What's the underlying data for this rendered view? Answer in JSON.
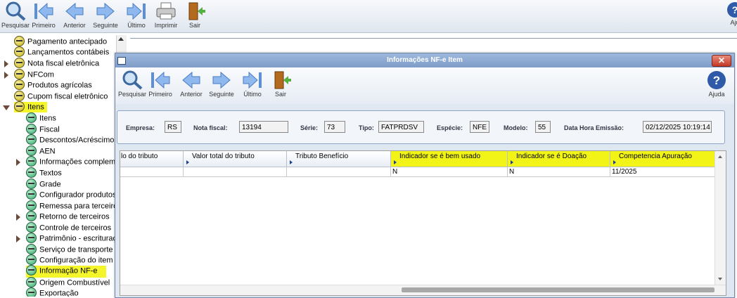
{
  "toolbar": {
    "items": [
      {
        "label": "Pesquisar",
        "icon": "search-icon"
      },
      {
        "label": "Primeiro",
        "icon": "first-arrow-icon"
      },
      {
        "label": "Anterior",
        "icon": "previous-arrow-icon"
      },
      {
        "label": "Seguinte",
        "icon": "next-arrow-icon"
      },
      {
        "label": "Último",
        "icon": "last-arrow-icon"
      },
      {
        "label": "Imprimir",
        "icon": "printer-icon"
      },
      {
        "label": "Sair",
        "icon": "exit-door-icon"
      }
    ],
    "help_label": "Aju"
  },
  "tree": {
    "items": [
      {
        "label": "Pagamento antecipado",
        "type": "folder"
      },
      {
        "label": "Lançamentos contábeis",
        "type": "folder"
      },
      {
        "label": "Nota fiscal eletrônica",
        "type": "folder"
      },
      {
        "label": "NFCom",
        "type": "folder"
      },
      {
        "label": "Produtos agrícolas",
        "type": "folder"
      },
      {
        "label": "Cupom fiscal eletrônico",
        "type": "folder"
      },
      {
        "label": "Itens",
        "type": "folder"
      },
      {
        "label": "Itens",
        "type": "leaf"
      },
      {
        "label": "Fiscal",
        "type": "leaf"
      },
      {
        "label": "Descontos/Acréscimos",
        "type": "leaf"
      },
      {
        "label": "AEN",
        "type": "leaf"
      },
      {
        "label": "Informações compleme",
        "type": "leaf"
      },
      {
        "label": "Textos",
        "type": "leaf"
      },
      {
        "label": "Grade",
        "type": "leaf"
      },
      {
        "label": "Configurador produtos",
        "type": "leaf"
      },
      {
        "label": "Remessa para terceiros",
        "type": "leaf"
      },
      {
        "label": "Retorno de terceiros",
        "type": "leaf"
      },
      {
        "label": "Controle de terceiros",
        "type": "leaf"
      },
      {
        "label": "Patrimônio - escrituraçã",
        "type": "leaf"
      },
      {
        "label": "Serviço de transporte",
        "type": "leaf"
      },
      {
        "label": "Configuração do item",
        "type": "leaf"
      },
      {
        "label": "Informação NF-e",
        "type": "leaf"
      },
      {
        "label": "Origem Combustível",
        "type": "leaf"
      },
      {
        "label": "Exportação",
        "type": "leaf"
      }
    ]
  },
  "dialog": {
    "title": "Informações NF-e Item",
    "close_label": "✕",
    "toolbar": {
      "items": [
        {
          "label": "Pesquisar"
        },
        {
          "label": "Primeiro"
        },
        {
          "label": "Anterior"
        },
        {
          "label": "Seguinte"
        },
        {
          "label": "Último"
        },
        {
          "label": "Sair"
        }
      ],
      "help_label": "Ajuda"
    },
    "fields": {
      "empresa_label": "Empresa:",
      "empresa": "RS",
      "nota_label": "Nota fiscal:",
      "nota": "13194",
      "serie_label": "Série:",
      "serie": "73",
      "tipo_label": "Tipo:",
      "tipo": "FATPRDSV",
      "especie_label": "Espécie:",
      "especie": "NFE",
      "modelo_label": "Modelo:",
      "modelo": "55",
      "data_label": "Data Hora Emissão:",
      "data": "02/12/2025 10:19:14"
    },
    "grid": {
      "columns": [
        "lo do tributo",
        "Valor total do tributo",
        "Tributo Benefício",
        "Indicador se é bem usado",
        "Indicador se é Doação",
        "Competencia Apuração"
      ],
      "rows": [
        [
          "",
          "",
          "",
          "N",
          "N",
          "11/2025"
        ]
      ]
    }
  },
  "colors": {
    "highlight": "#f4f52a",
    "title_bar": "#8aa6d0",
    "close_button": "#c9402c"
  }
}
